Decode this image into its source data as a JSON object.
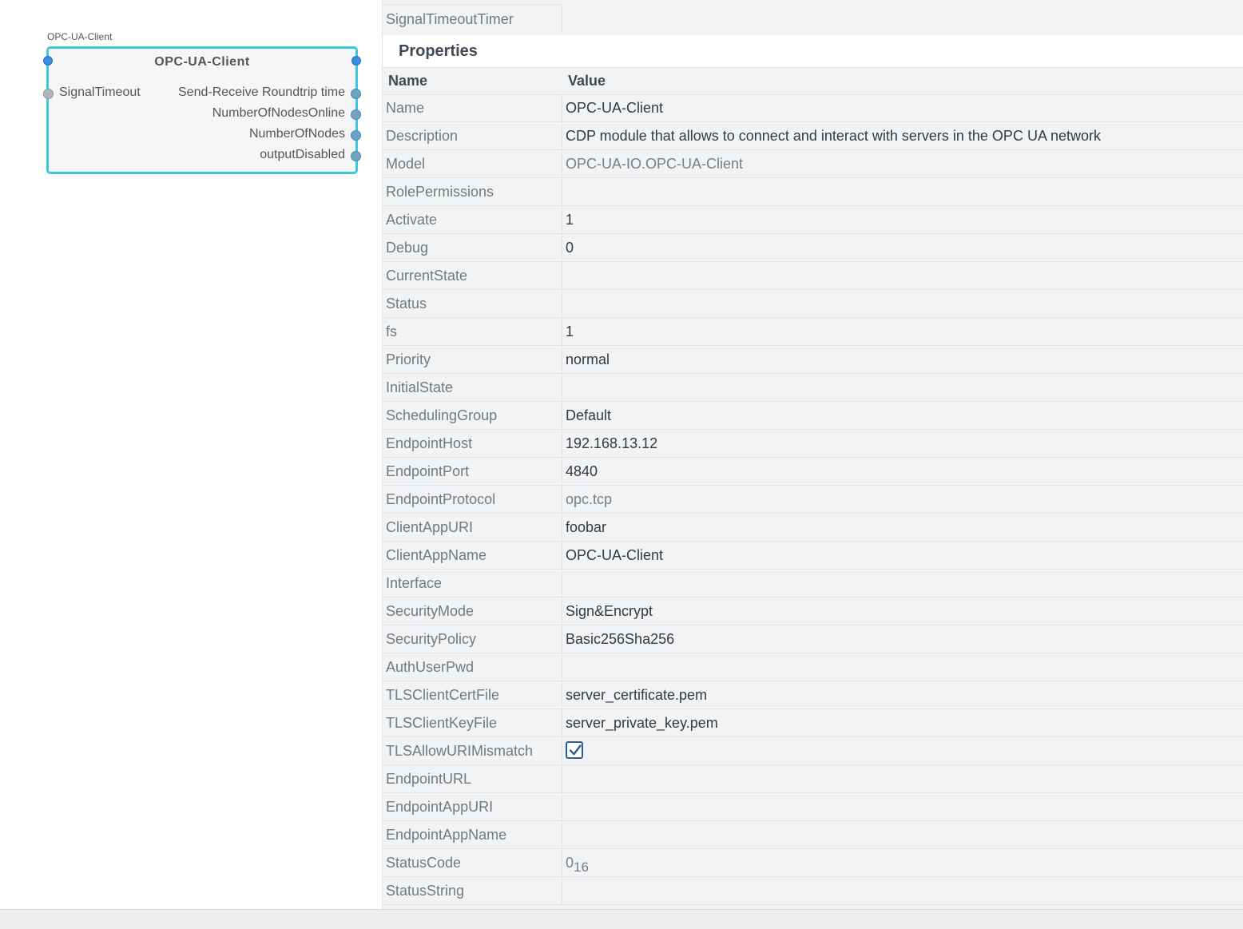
{
  "block": {
    "caption": "OPC-UA-Client",
    "title": "OPC-UA-Client",
    "input_port": "SignalTimeout",
    "output_ports": [
      "Send-Receive Roundtrip time",
      "NumberOfNodesOnline",
      "NumberOfNodes",
      "outputDisabled"
    ]
  },
  "panel": {
    "top_row_name": "SignalTimeoutTimer",
    "section_title": "Properties",
    "col_name": "Name",
    "col_value": "Value",
    "rows": [
      {
        "name": "Name",
        "value": "OPC-UA-Client"
      },
      {
        "name": "Description",
        "value": "CDP module that allows to connect and interact with servers in the OPC UA network"
      },
      {
        "name": "Model",
        "value": "OPC-UA-IO.OPC-UA-Client"
      },
      {
        "name": "RolePermissions",
        "value": ""
      },
      {
        "name": "Activate",
        "value": "1"
      },
      {
        "name": "Debug",
        "value": "0"
      },
      {
        "name": "CurrentState",
        "value": ""
      },
      {
        "name": "Status",
        "value": ""
      },
      {
        "name": "fs",
        "value": "1"
      },
      {
        "name": "Priority",
        "value": "normal"
      },
      {
        "name": "InitialState",
        "value": ""
      },
      {
        "name": "SchedulingGroup",
        "value": "Default"
      },
      {
        "name": "EndpointHost",
        "value": "192.168.13.12"
      },
      {
        "name": "EndpointPort",
        "value": "4840"
      },
      {
        "name": "EndpointProtocol",
        "value": "opc.tcp"
      },
      {
        "name": "ClientAppURI",
        "value": "foobar"
      },
      {
        "name": "ClientAppName",
        "value": "OPC-UA-Client"
      },
      {
        "name": "Interface",
        "value": ""
      },
      {
        "name": "SecurityMode",
        "value": "Sign&Encrypt"
      },
      {
        "name": "SecurityPolicy",
        "value": "Basic256Sha256"
      },
      {
        "name": "AuthUserPwd",
        "value": ""
      },
      {
        "name": "TLSClientCertFile",
        "value": "server_certificate.pem"
      },
      {
        "name": "TLSClientKeyFile",
        "value": "server_private_key.pem"
      },
      {
        "name": "TLSAllowURIMismatch",
        "checked": true
      },
      {
        "name": "EndpointURL",
        "value": ""
      },
      {
        "name": "EndpointAppURI",
        "value": ""
      },
      {
        "name": "EndpointAppName",
        "value": ""
      },
      {
        "name": "StatusCode",
        "value": "0",
        "sub": "16"
      },
      {
        "name": "StatusString",
        "value": ""
      }
    ]
  },
  "colors": {
    "block_border": "#3ec8dc",
    "checkbox_border": "#2b5f8f"
  },
  "icons": {
    "checkbox": "checkmark-icon",
    "port": "port-dot-icon"
  }
}
